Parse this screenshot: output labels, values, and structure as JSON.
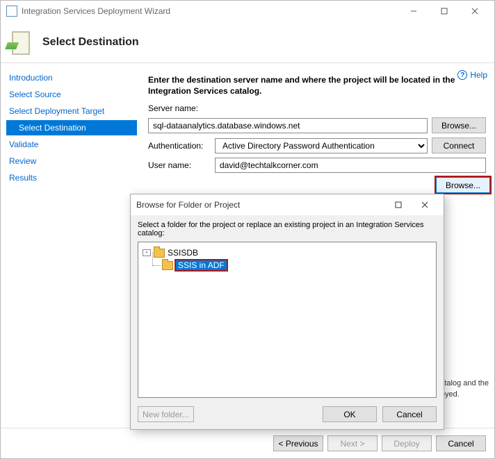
{
  "window": {
    "title": "Integration Services Deployment Wizard"
  },
  "header": {
    "title": "Select Destination"
  },
  "help": {
    "label": "Help"
  },
  "nav": {
    "intro": "Introduction",
    "source": "Select Source",
    "target": "Select Deployment Target",
    "destination": "Select Destination",
    "validate": "Validate",
    "review": "Review",
    "results": "Results"
  },
  "main": {
    "instruction": "Enter the destination server name and where the project will be located in the Integration Services catalog.",
    "serverLabel": "Server name:",
    "serverValue": "sql-dataanalytics.database.windows.net",
    "browseBtn": "Browse...",
    "authLabel": "Authentication:",
    "authValue": "Active Directory Password Authentication",
    "connectBtn": "Connect",
    "userLabel": "User name:",
    "userValue": "david@techtalkcorner.com",
    "pathBrowseBtn": "Browse...",
    "hintTail": "s catalog and the",
    "hintTail2": "eployed."
  },
  "footer": {
    "previous": "< Previous",
    "next": "Next >",
    "deploy": "Deploy",
    "cancel": "Cancel"
  },
  "dialog": {
    "title": "Browse for Folder or Project",
    "message": "Select a folder for the project or replace an existing project in an Integration Services catalog:",
    "root": "SSISDB",
    "child": "SSIS in ADF",
    "newFolder": "New folder...",
    "ok": "OK",
    "cancel": "Cancel"
  }
}
